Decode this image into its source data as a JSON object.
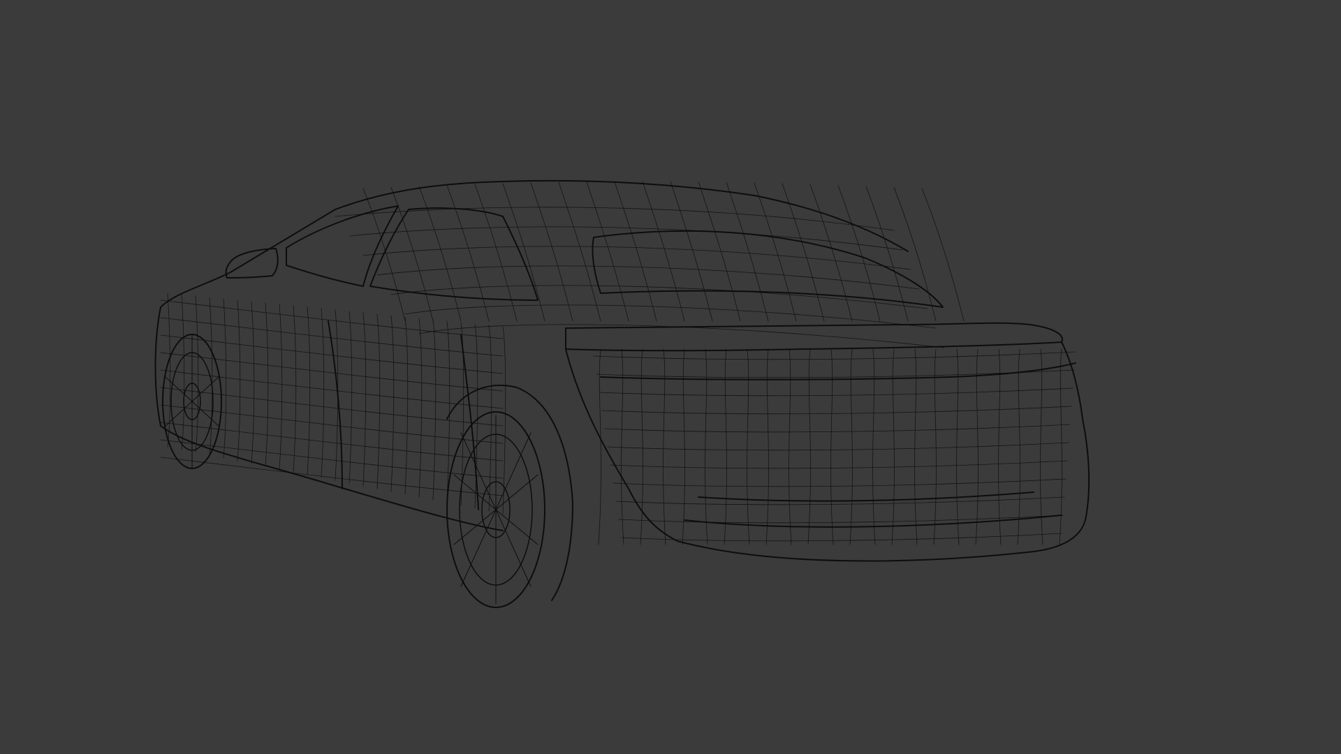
{
  "viewport": {
    "background_color": "#3b3b3b",
    "wire_color": "#0d0d0d",
    "subject": "car-wireframe",
    "display_mode": "wireframe"
  }
}
